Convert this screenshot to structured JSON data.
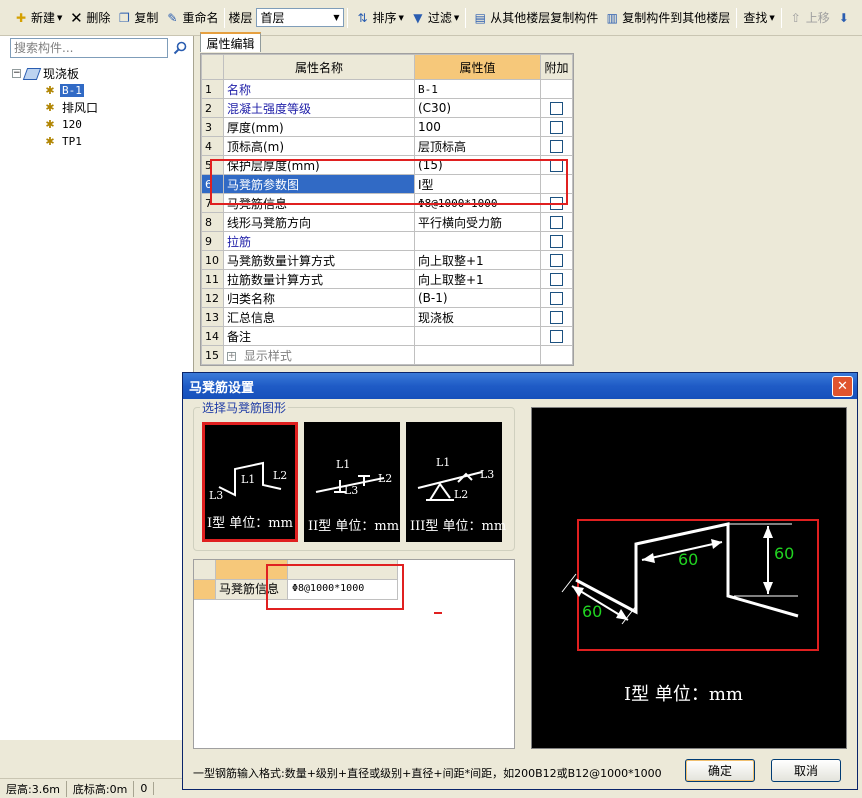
{
  "toolbar": {
    "new_label": "新建",
    "delete_label": "删除",
    "copy_label": "复制",
    "rename_label": "重命名",
    "floor_label": "楼层",
    "floor_value": "首层",
    "sort_label": "排序",
    "filter_label": "过滤",
    "copy_from_label": "从其他楼层复制构件",
    "copy_to_label": "复制构件到其他楼层",
    "find_label": "查找",
    "move_up_label": "上移"
  },
  "left_panel": {
    "search_placeholder": "搜索构件...",
    "tree_root": "现浇板",
    "tree_items": [
      "B-1",
      "排风口",
      "120",
      "TP1"
    ]
  },
  "status_bar": {
    "top_elev": "层高:3.6m",
    "bottom_elev": "底标高:0m",
    "extra": "0"
  },
  "property_panel": {
    "tab_label": "属性编辑",
    "col_name": "属性名称",
    "col_value": "属性值",
    "col_extra": "附加",
    "rows": [
      {
        "num": "1",
        "name": "名称",
        "value": "B-1"
      },
      {
        "num": "2",
        "name": "混凝土强度等级",
        "value": "(C30)"
      },
      {
        "num": "3",
        "name": "厚度(mm)",
        "value": "100"
      },
      {
        "num": "4",
        "name": "顶标高(m)",
        "value": "层顶标高"
      },
      {
        "num": "5",
        "name": "保护层厚度(mm)",
        "value": "(15)"
      },
      {
        "num": "6",
        "name": "马凳筋参数图",
        "value": "I型"
      },
      {
        "num": "7",
        "name": "马凳筋信息",
        "value": "Φ8@1000*1000"
      },
      {
        "num": "8",
        "name": "线形马凳筋方向",
        "value": "平行横向受力筋"
      },
      {
        "num": "9",
        "name": "拉筋",
        "value": ""
      },
      {
        "num": "10",
        "name": "马凳筋数量计算方式",
        "value": "向上取整+1"
      },
      {
        "num": "11",
        "name": "拉筋数量计算方式",
        "value": "向上取整+1"
      },
      {
        "num": "12",
        "name": "归类名称",
        "value": "(B-1)"
      },
      {
        "num": "13",
        "name": "汇总信息",
        "value": "现浇板"
      },
      {
        "num": "14",
        "name": "备注",
        "value": ""
      },
      {
        "num": "15",
        "name": "显示样式",
        "value": ""
      }
    ]
  },
  "dialog": {
    "title": "马凳筋设置",
    "close_glyph": "✕",
    "group_title": "选择马凳筋图形",
    "shapes": [
      {
        "caption": "I型 单位：mm",
        "labels": [
          "L1",
          "L2",
          "L3"
        ]
      },
      {
        "caption": "II型 单位：mm",
        "labels": [
          "L1",
          "L2",
          "L3"
        ]
      },
      {
        "caption": "III型 单位：mm",
        "labels": [
          "L1",
          "L2",
          "L3"
        ]
      }
    ],
    "info_row_name": "马凳筋信息",
    "info_row_value": "Φ8@1000*1000",
    "preview_dims": [
      "60",
      "60",
      "60"
    ],
    "preview_caption": "I型 单位：mm",
    "hint": "一型钢筋输入格式:数量+级别+直径或级别+直径+间距*间距，如200B12或B12@1000*1000",
    "ok_label": "确定",
    "cancel_label": "取消"
  }
}
